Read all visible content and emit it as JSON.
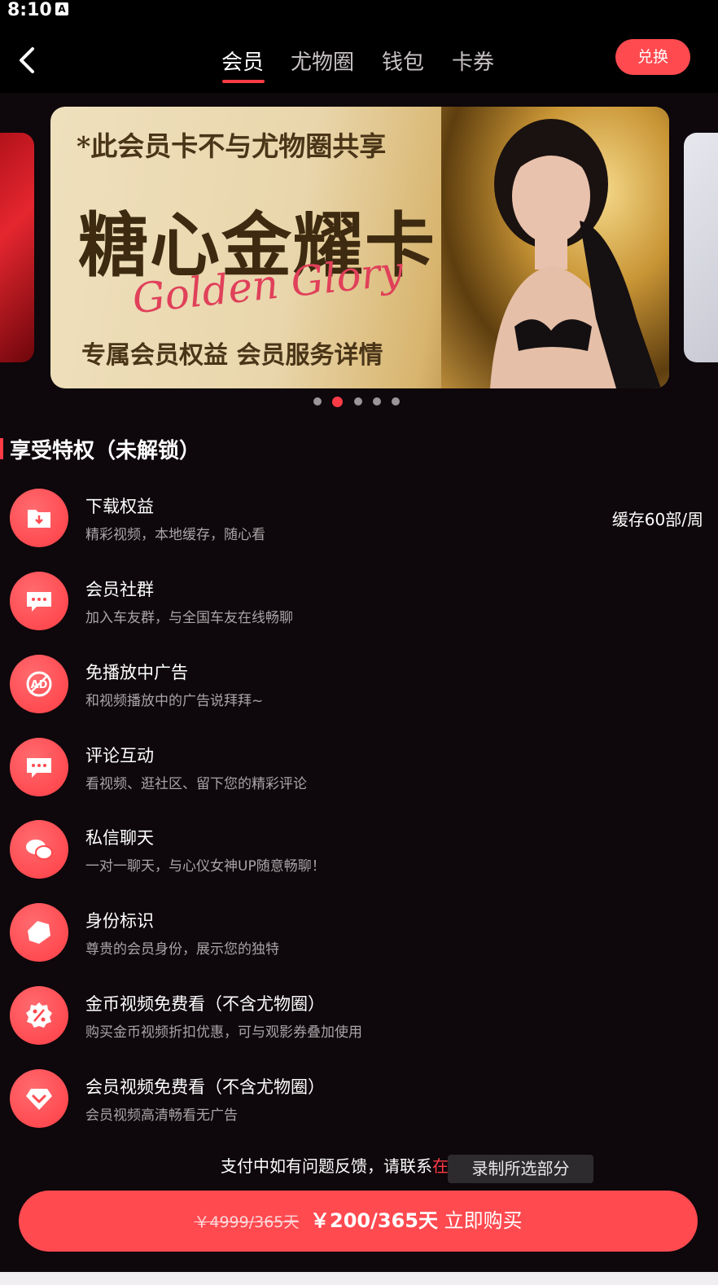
{
  "status": {
    "time": "8:10",
    "notif_icon": "A"
  },
  "header": {
    "back_icon": "chevron-left-icon",
    "tabs": [
      {
        "label": "会员",
        "active": true
      },
      {
        "label": "尤物圈",
        "active": false
      },
      {
        "label": "钱包",
        "active": false
      },
      {
        "label": "卡券",
        "active": false
      }
    ],
    "redeem_label": "兑换"
  },
  "banner": {
    "note": "*此会员卡不与尤物圈共享",
    "title": "糖心金耀卡",
    "script": "Golden Glory",
    "subtitle": "专属会员权益  会员服务详情",
    "active_index": 1,
    "count": 5
  },
  "section": {
    "title": "享受特权（未解锁）"
  },
  "privileges": [
    {
      "title": "下载权益",
      "desc": "精彩视频，本地缓存，随心看",
      "extra": "缓存60部/周",
      "icon": "download-folder-icon"
    },
    {
      "title": "会员社群",
      "desc": "加入车友群，与全国车友在线畅聊",
      "extra": "",
      "icon": "chat-bubble-icon"
    },
    {
      "title": "免播放中广告",
      "desc": "和视频播放中的广告说拜拜~",
      "extra": "",
      "icon": "no-ads-icon"
    },
    {
      "title": "评论互动",
      "desc": "看视频、逛社区、留下您的精彩评论",
      "extra": "",
      "icon": "comment-icon"
    },
    {
      "title": "私信聊天",
      "desc": "一对一聊天，与心仪女神UP随意畅聊！",
      "extra": "",
      "icon": "private-chat-icon"
    },
    {
      "title": "身份标识",
      "desc": "尊贵的会员身份，展示您的独特",
      "extra": "",
      "icon": "badge-tag-icon"
    },
    {
      "title": "金币视频免费看（不含尤物圈）",
      "desc": "购买金币视频折扣优惠，可与观影券叠加使用",
      "extra": "",
      "icon": "discount-icon"
    },
    {
      "title": "会员视频免费看（不含尤物圈）",
      "desc": "会员视频高清畅看无广告",
      "extra": "",
      "icon": "diamond-icon"
    }
  ],
  "support": {
    "text": "支付中如有问题反馈，请联系",
    "link": "在线"
  },
  "record_tip": "录制所选部分",
  "buy": {
    "old_price": "￥4999/365天",
    "price": "￥200/365天",
    "action": "立即购买"
  },
  "colors": {
    "accent": "#ff4a50",
    "background": "#0e070b",
    "muted": "#a9a4a7"
  }
}
